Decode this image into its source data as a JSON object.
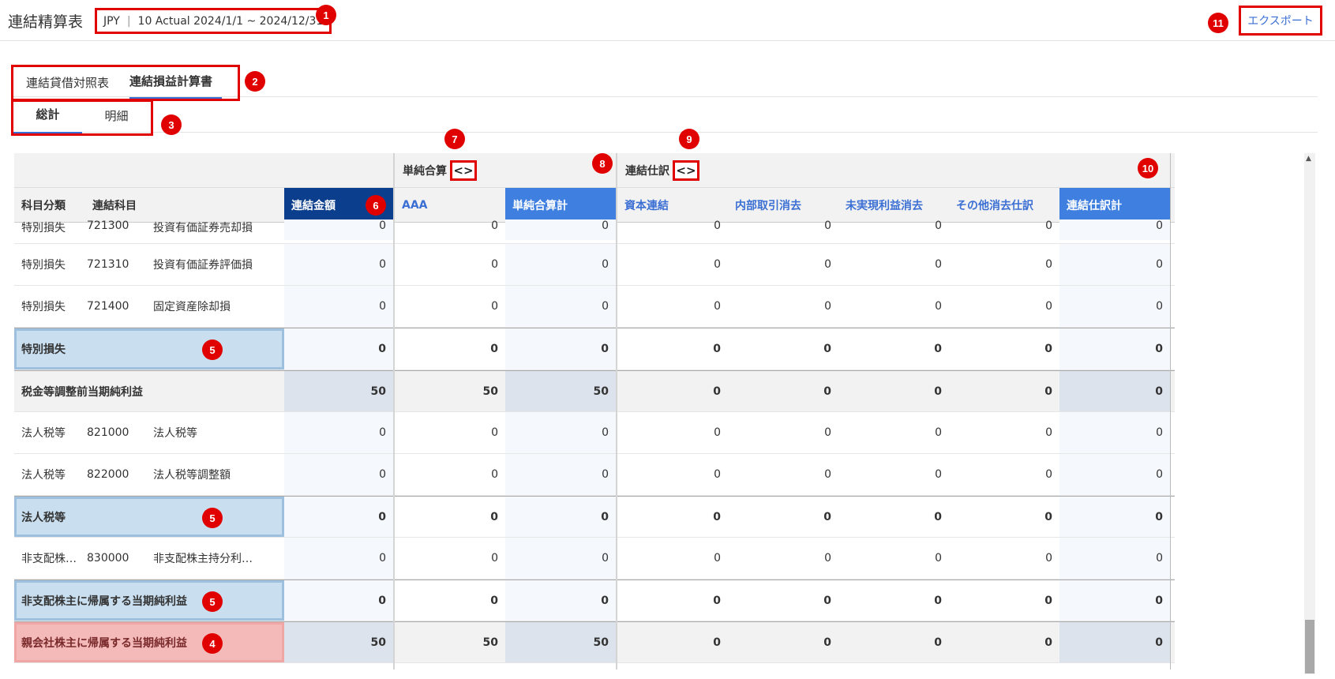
{
  "header": {
    "title": "連結精算表",
    "currency": "JPY",
    "separator": "|",
    "period": "10 Actual 2024/1/1 ~ 2024/12/31",
    "export_label": "エクスポート"
  },
  "tabs": {
    "statements": [
      {
        "label": "連結貸借対照表",
        "active": false
      },
      {
        "label": "連結損益計算書",
        "active": true
      }
    ],
    "views": [
      {
        "label": "総計",
        "active": true
      },
      {
        "label": "明細",
        "active": false
      }
    ]
  },
  "table": {
    "groups": {
      "simple": "単純合算",
      "consolidation": "連結仕訳",
      "toggle": "<>"
    },
    "columns": {
      "category": "科目分類",
      "account": "連結科目",
      "consolidated": "連結金額",
      "aaa": "AAA",
      "simple_total": "単純合算計",
      "capital": "資本連結",
      "intercompany": "内部取引消去",
      "unrealized": "未実現利益消去",
      "other": "その他消去仕訳",
      "journal_total": "連結仕訳計"
    },
    "rows": [
      {
        "category": "特別損失",
        "code": "721300",
        "name": "投資有価証券売却損",
        "values": [
          "0",
          "0",
          "0",
          "0",
          "0",
          "0",
          "0",
          "0"
        ]
      },
      {
        "category": "特別損失",
        "code": "721310",
        "name": "投資有価証券評価損",
        "values": [
          "0",
          "0",
          "0",
          "0",
          "0",
          "0",
          "0",
          "0"
        ]
      },
      {
        "category": "特別損失",
        "code": "721400",
        "name": "固定資産除却損",
        "values": [
          "0",
          "0",
          "0",
          "0",
          "0",
          "0",
          "0",
          "0"
        ]
      },
      {
        "label": "特別損失",
        "values": [
          "0",
          "0",
          "0",
          "0",
          "0",
          "0",
          "0",
          "0"
        ]
      },
      {
        "label": "税金等調整前当期純利益",
        "values": [
          "50",
          "50",
          "50",
          "0",
          "0",
          "0",
          "0",
          "0"
        ]
      },
      {
        "category": "法人税等",
        "code": "821000",
        "name": "法人税等",
        "values": [
          "0",
          "0",
          "0",
          "0",
          "0",
          "0",
          "0",
          "0"
        ]
      },
      {
        "category": "法人税等",
        "code": "822000",
        "name": "法人税等調整額",
        "values": [
          "0",
          "0",
          "0",
          "0",
          "0",
          "0",
          "0",
          "0"
        ]
      },
      {
        "label": "法人税等",
        "values": [
          "0",
          "0",
          "0",
          "0",
          "0",
          "0",
          "0",
          "0"
        ]
      },
      {
        "category": "非支配株…",
        "code": "830000",
        "name": "非支配株主持分利…",
        "values": [
          "0",
          "0",
          "0",
          "0",
          "0",
          "0",
          "0",
          "0"
        ]
      },
      {
        "label": "非支配株主に帰属する当期純利益",
        "values": [
          "0",
          "0",
          "0",
          "0",
          "0",
          "0",
          "0",
          "0"
        ]
      },
      {
        "label": "親会社株主に帰属する当期純利益",
        "values": [
          "50",
          "50",
          "50",
          "0",
          "0",
          "0",
          "0",
          "0"
        ]
      }
    ]
  },
  "annotations": [
    "1",
    "2",
    "3",
    "4",
    "5",
    "6",
    "7",
    "8",
    "9",
    "10",
    "11"
  ]
}
